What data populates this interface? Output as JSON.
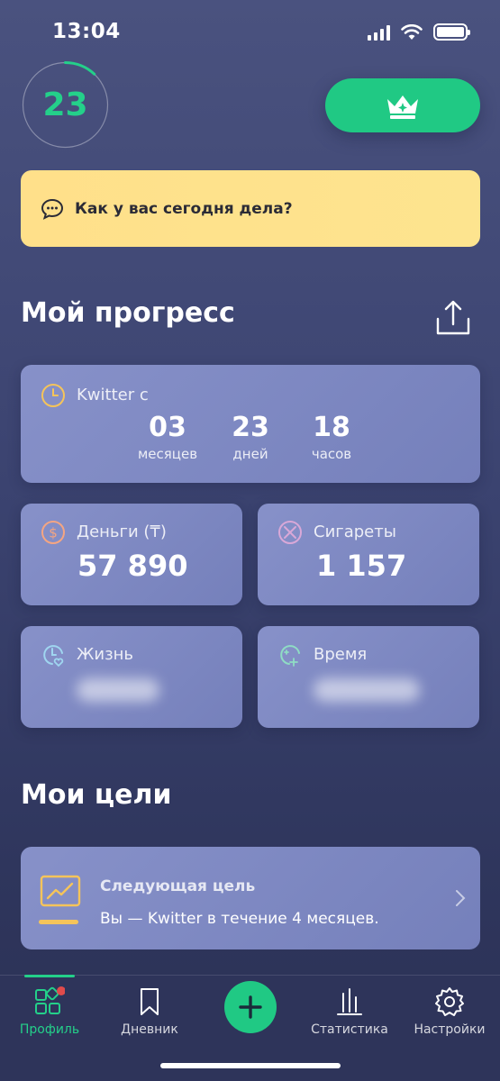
{
  "status_bar": {
    "time": "13:04"
  },
  "header": {
    "streak_count": "23",
    "streak_progress": 0.12
  },
  "mood": {
    "question": "Как у вас сегодня дела?"
  },
  "progress_section": {
    "title": "Мой прогресс",
    "quit_timer": {
      "label": "Kwitter с",
      "months_value": "03",
      "months_unit": "месяцев",
      "days_value": "23",
      "days_unit": "дней",
      "hours_value": "18",
      "hours_unit": "часов"
    },
    "money": {
      "label": "Деньги (₸)",
      "value": "57 890"
    },
    "cigarettes": {
      "label": "Сигареты",
      "value": "1 157"
    },
    "life": {
      "label": "Жизнь"
    },
    "time": {
      "label": "Время"
    }
  },
  "goals_section": {
    "title": "Мои цели",
    "next_goal": {
      "title": "Следующая цель",
      "description": "Вы — Kwitter в течение 4 месяцев."
    }
  },
  "tabbar": {
    "profile": "Профиль",
    "diary": "Дневник",
    "stats": "Статистика",
    "settings": "Настройки"
  },
  "colors": {
    "accent": "#24d08a",
    "mood_card": "#fde48f",
    "card": "#8791c9"
  }
}
